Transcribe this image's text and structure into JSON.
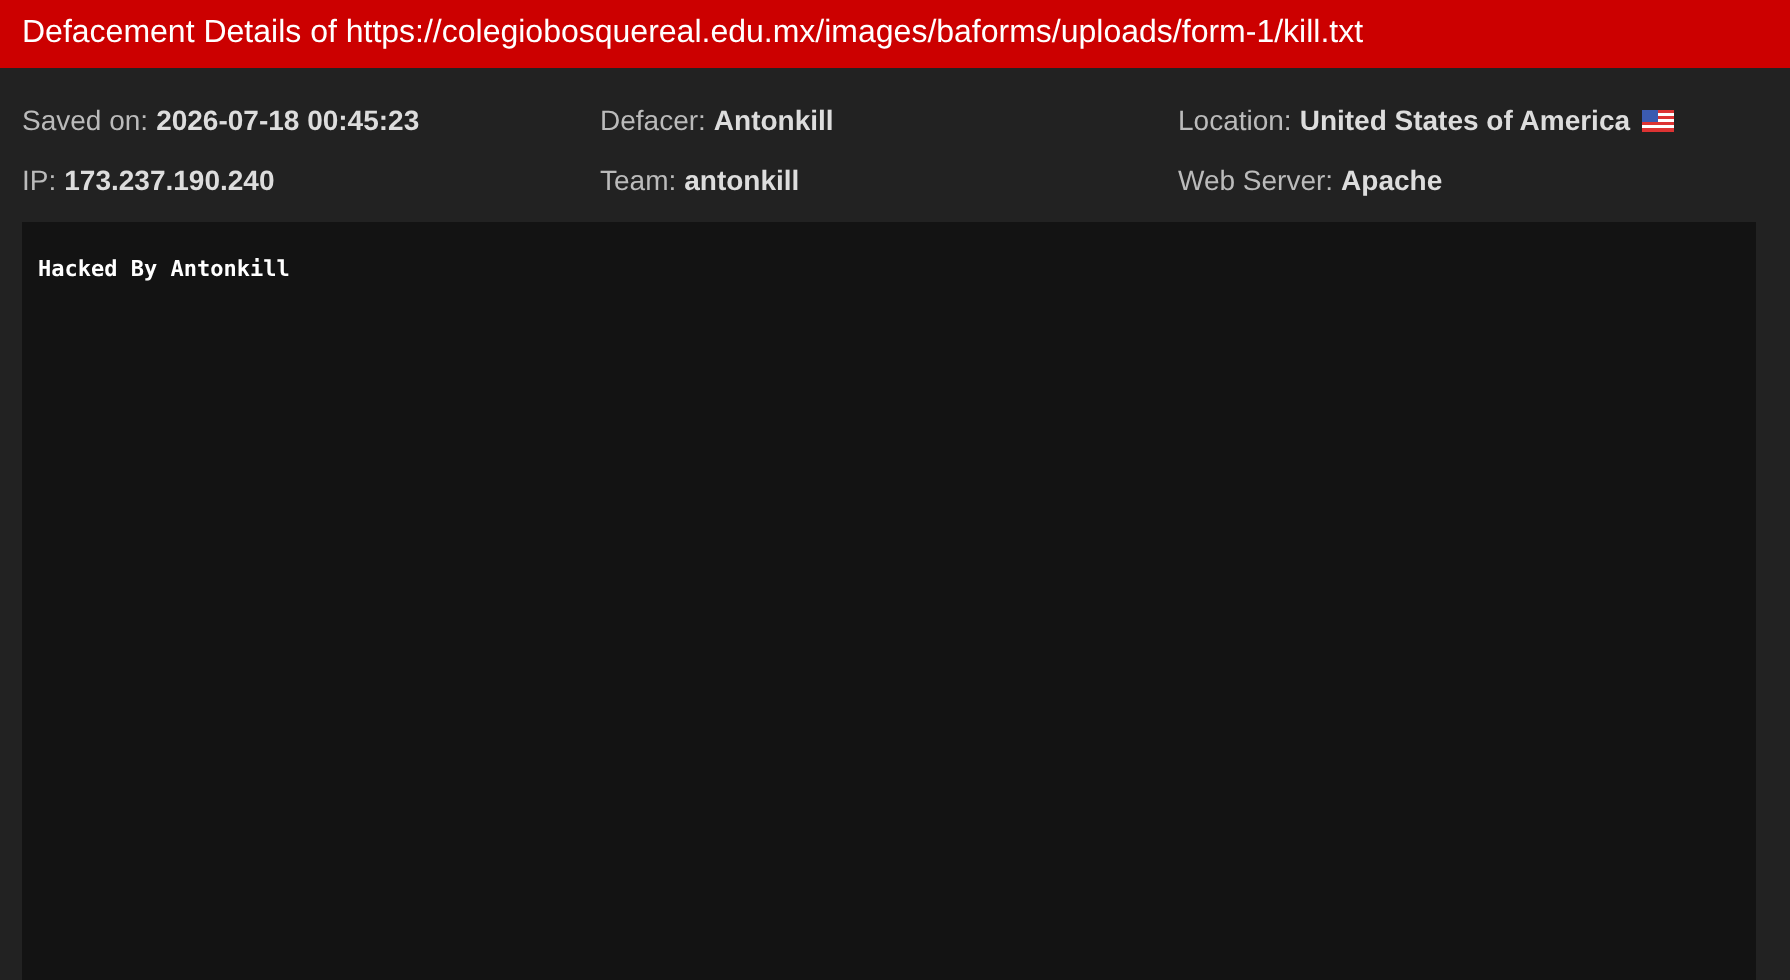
{
  "header": {
    "title": "Defacement Details of https://colegiobosquereal.edu.mx/images/baforms/uploads/form-1/kill.txt"
  },
  "details": [
    {
      "label": "Saved on:",
      "value": "2026-07-18 00:45:23"
    },
    {
      "label": "Defacer:",
      "value": "Antonkill"
    },
    {
      "label": "Location:",
      "value": "United States of America",
      "flag": true
    },
    {
      "label": "IP:",
      "value": "173.237.190.240"
    },
    {
      "label": "Team:",
      "value": "antonkill"
    },
    {
      "label": "Web Server:",
      "value": "Apache"
    }
  ],
  "content": {
    "text": "Hacked By Antonkill"
  }
}
